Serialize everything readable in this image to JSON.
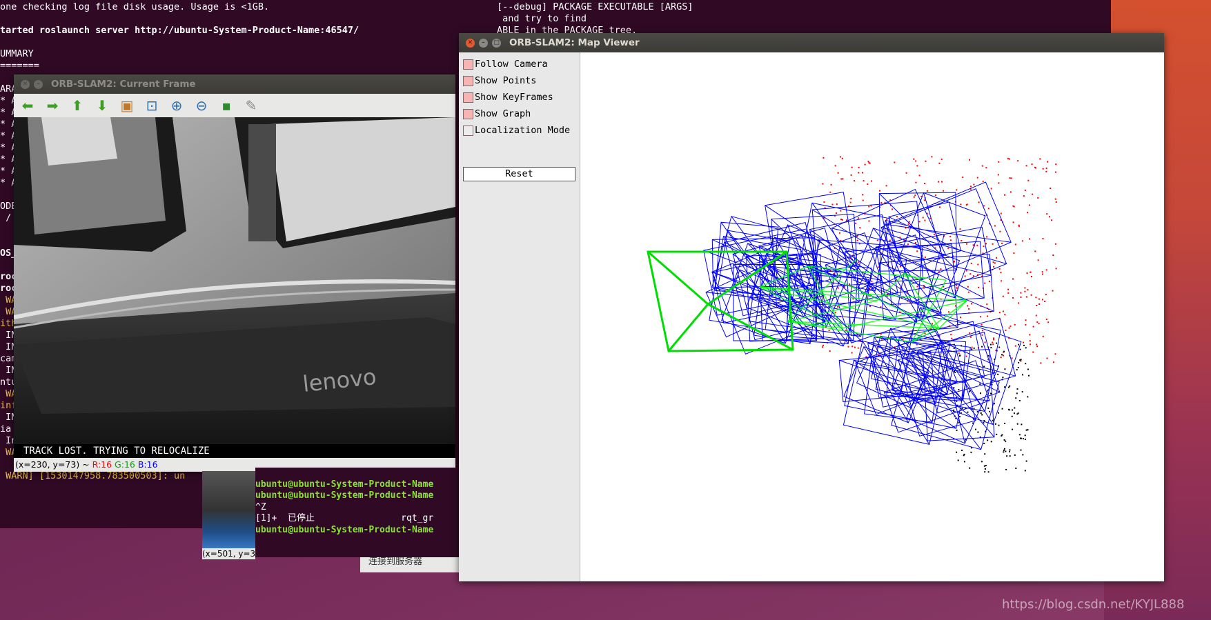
{
  "terminal_main": {
    "lines": [
      {
        "t": "one checking log file disk usage. Usage is <1GB.",
        "c": "info"
      },
      {
        "t": "",
        "c": "info"
      },
      {
        "t": "tarted roslaunch server http://ubuntu-System-Product-Name:46547/",
        "c": "bold"
      },
      {
        "t": "",
        "c": "info"
      },
      {
        "t": "UMMARY",
        "c": "info"
      },
      {
        "t": "=======",
        "c": "info"
      },
      {
        "t": "",
        "c": "info"
      },
      {
        "t": "ARA",
        "c": "info"
      },
      {
        "t": "* A",
        "c": "info"
      },
      {
        "t": "* A",
        "c": "info"
      },
      {
        "t": "* A",
        "c": "info"
      },
      {
        "t": "* A",
        "c": "info"
      },
      {
        "t": "* A",
        "c": "info"
      },
      {
        "t": "* A",
        "c": "info"
      },
      {
        "t": "* A",
        "c": "info"
      },
      {
        "t": "* A",
        "c": "info"
      },
      {
        "t": "",
        "c": "info"
      },
      {
        "t": "ODE",
        "c": "info"
      },
      {
        "t": " /",
        "c": "info"
      },
      {
        "t": "",
        "c": "info"
      },
      {
        "t": "",
        "c": "info"
      },
      {
        "t": "OS_",
        "c": "bold"
      },
      {
        "t": "",
        "c": "info"
      },
      {
        "t": "roc",
        "c": "bold"
      },
      {
        "t": "roc",
        "c": "bold"
      },
      {
        "t": " WA",
        "c": "warn"
      },
      {
        "t": " WA",
        "c": "warn"
      },
      {
        "t": "ith",
        "c": "warn"
      },
      {
        "t": " IN",
        "c": "info"
      },
      {
        "t": " IN",
        "c": "info"
      },
      {
        "t": "cam",
        "c": "info"
      },
      {
        "t": " IN",
        "c": "info"
      },
      {
        "t": "ntu",
        "c": "info"
      },
      {
        "t": " WA",
        "c": "warn"
      },
      {
        "t": "inf",
        "c": "warn"
      },
      {
        "t": " IN",
        "c": "info"
      },
      {
        "t": "ia",
        "c": "info"
      },
      {
        "t": " In",
        "c": "info"
      },
      {
        "t": " WARN] [1530147958.781815959]: un",
        "c": "warn"
      },
      {
        "t": "",
        "c": "info"
      },
      {
        "t": " WARN] [1530147958.783500503]: un",
        "c": "warn"
      }
    ],
    "right_lines": [
      "[--debug] PACKAGE EXECUTABLE [ARGS]",
      " and try to find",
      "ABLE in the PACKAGE tree."
    ]
  },
  "current_frame": {
    "title": "ORB-SLAM2: Current Frame",
    "toolbar": [
      {
        "name": "arrow-left-icon",
        "glyph": "⬅",
        "color": "#3aa020"
      },
      {
        "name": "arrow-right-icon",
        "glyph": "➡",
        "color": "#3aa020"
      },
      {
        "name": "arrow-up-icon",
        "glyph": "⬆",
        "color": "#3aa020"
      },
      {
        "name": "arrow-down-icon",
        "glyph": "⬇",
        "color": "#3aa020"
      },
      {
        "name": "image-icon",
        "glyph": "▣",
        "color": "#c07828"
      },
      {
        "name": "zoom-fit-icon",
        "glyph": "⊡",
        "color": "#2a70b0"
      },
      {
        "name": "zoom-in-icon",
        "glyph": "⊕",
        "color": "#2a70b0"
      },
      {
        "name": "zoom-out-icon",
        "glyph": "⊖",
        "color": "#2a70b0"
      },
      {
        "name": "save-icon",
        "glyph": "▪",
        "color": "#2e8a2e"
      },
      {
        "name": "brush-icon",
        "glyph": "✎",
        "color": "#888888"
      }
    ],
    "status_text": "TRACK LOST. TRYING TO RELOCALIZE",
    "pixel_pos": "(x=230, y=73) ~",
    "pixel_r": "R:16",
    "pixel_g": "G:16",
    "pixel_b": "B:16"
  },
  "small_terminal": {
    "lines": [
      {
        "t": "",
        "c": "info"
      },
      {
        "t": "ubuntu@ubuntu-System-Product-Name",
        "c": "green"
      },
      {
        "t": "ubuntu@ubuntu-System-Product-Name",
        "c": "green"
      },
      {
        "t": "^Z",
        "c": "info"
      },
      {
        "t": "[1]+  已停止                rqt_gr",
        "c": "info"
      },
      {
        "t": "ubuntu@ubuntu-System-Product-Name",
        "c": "green"
      }
    ],
    "thumb_label": "(x=501, y=3",
    "connect_text": "连接到服务器"
  },
  "map_viewer": {
    "title": "ORB-SLAM2: Map Viewer",
    "options": [
      {
        "name": "follow-camera-checkbox",
        "label": "Follow Camera",
        "checked": true
      },
      {
        "name": "show-points-checkbox",
        "label": "Show Points",
        "checked": true
      },
      {
        "name": "show-keyframes-checkbox",
        "label": "Show KeyFrames",
        "checked": true
      },
      {
        "name": "show-graph-checkbox",
        "label": "Show Graph",
        "checked": true
      },
      {
        "name": "localization-mode-checkbox",
        "label": "Localization Mode",
        "checked": false
      }
    ],
    "reset_label": "Reset",
    "colors": {
      "points": "#ff0000",
      "ref_points": "#000000",
      "keyframes": "#0000ff",
      "graph": "#00ff00",
      "camera": "#00dd00"
    }
  },
  "watermark": "https://blog.csdn.net/KYJL888"
}
